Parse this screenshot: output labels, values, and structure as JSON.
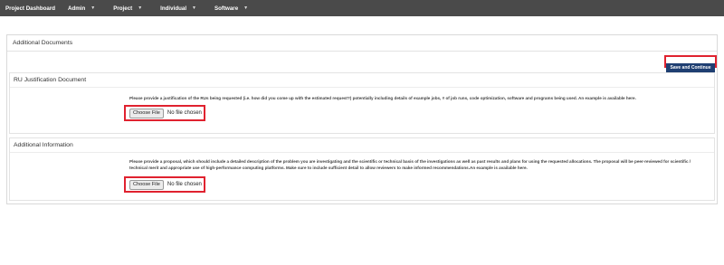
{
  "navbar": {
    "brand": "Project Dashboard",
    "items": [
      {
        "label": "Admin"
      },
      {
        "label": "Project"
      },
      {
        "label": "Individual"
      },
      {
        "label": "Software"
      }
    ]
  },
  "panel": {
    "title": "Additional Documents",
    "save_label": "Save and Continue"
  },
  "sections": [
    {
      "title": "RU Justification Document",
      "description": "Please provide a justification of the RUs being requested (i.e. how did you come up with the estimated request?) potentially including details of example jobs, # of job runs, code optimization, software and programs being used. An example is available here.",
      "file_button": "Choose File",
      "file_status": "No file chosen"
    },
    {
      "title": "Additional Information",
      "description": "Please provide a proposal, which should include a detailed description of the problem you are investigating and the scientific or technical basis of the investigations as well as past results and plans for using the requested allocations. The proposal will be peer-reviewed for scientific / technical merit and appropriate use of high-performance computing platforms. Make sure to include sufficient detail to allow reviewers to make informed recommendations.An example is available here.",
      "file_button": "Choose File",
      "file_status": "No file chosen"
    }
  ],
  "colors": {
    "navbar_bg": "#4a4a4a",
    "button_bg": "#1f3f72",
    "highlight": "#e0222f"
  }
}
